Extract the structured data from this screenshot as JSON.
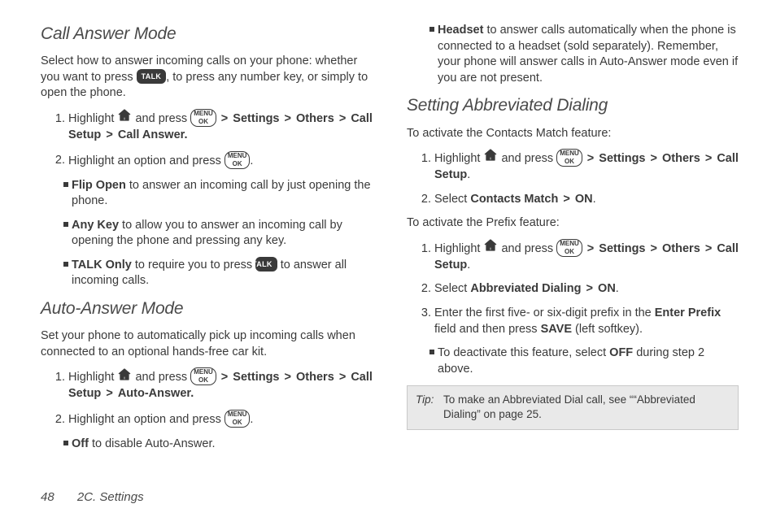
{
  "headings": {
    "h1": "Call Answer Mode",
    "h2": "Auto-Answer Mode",
    "h3": "Setting Abbreviated Dialing"
  },
  "callAnswer": {
    "intro": "Select how to answer incoming calls on your phone: whether you want to press ",
    "intro2": ", to press any number key, or simply to open the phone.",
    "step1a": "Highlight ",
    "step1b": " and press ",
    "navSettings": "Settings",
    "navOthers": "Others",
    "navCallSetup": "Call Setup",
    "navCallAnswer": "Call Answer.",
    "step2a": "Highlight an option and press ",
    "flipLabel": "Flip Open",
    "flipText": " to answer an incoming call by just opening the phone.",
    "anyLabel": "Any Key",
    "anyText": " to allow you to answer an incoming call by opening the phone and pressing any key.",
    "talkLabel": "TALK Only",
    "talkText1": " to require you to press ",
    "talkText2": " to answer all incoming calls."
  },
  "autoAnswer": {
    "intro": "Set your phone to automatically pick up incoming calls when connected to an optional hands-free car kit.",
    "step1a": "Highlight ",
    "step1b": " and press ",
    "navAuto": "Auto-Answer.",
    "step2a": "Highlight an option and press ",
    "offLabel": "Off",
    "offText": " to disable Auto-Answer.",
    "headsetLabel": "Headset",
    "headsetText": " to answer calls automatically when the phone is connected to a headset (sold separately). Remember, your phone will answer calls in Auto-Answer mode even if you are not present."
  },
  "abbr": {
    "introContacts": "To activate the Contacts Match feature:",
    "step1a": "Highlight ",
    "step1b": " and press ",
    "callSetupDot": "Call Setup",
    "contactsSelect": "Select ",
    "contactsMatch": "Contacts Match",
    "on": "ON",
    "dot": ".",
    "introPrefix": "To activate the Prefix feature:",
    "abbrDial": "Abbreviated Dialing",
    "step3a": "Enter the first five- or six-digit prefix in the ",
    "enterPrefix": "Enter Prefix",
    "step3b": " field and then press ",
    "save": "SAVE",
    "step3c": " (left softkey).",
    "deact1": "To deactivate this feature, select ",
    "off": "OFF",
    "deact2": " during step 2 above."
  },
  "tip": {
    "label": "Tip:",
    "text": "To make an Abbreviated Dial call, see ““Abbreviated Dialing” on page 25."
  },
  "icons": {
    "talk": "TALK",
    "menu": "MENU",
    "ok": "OK"
  },
  "footer": {
    "page": "48",
    "section": "2C. Settings"
  },
  "gt": ">"
}
